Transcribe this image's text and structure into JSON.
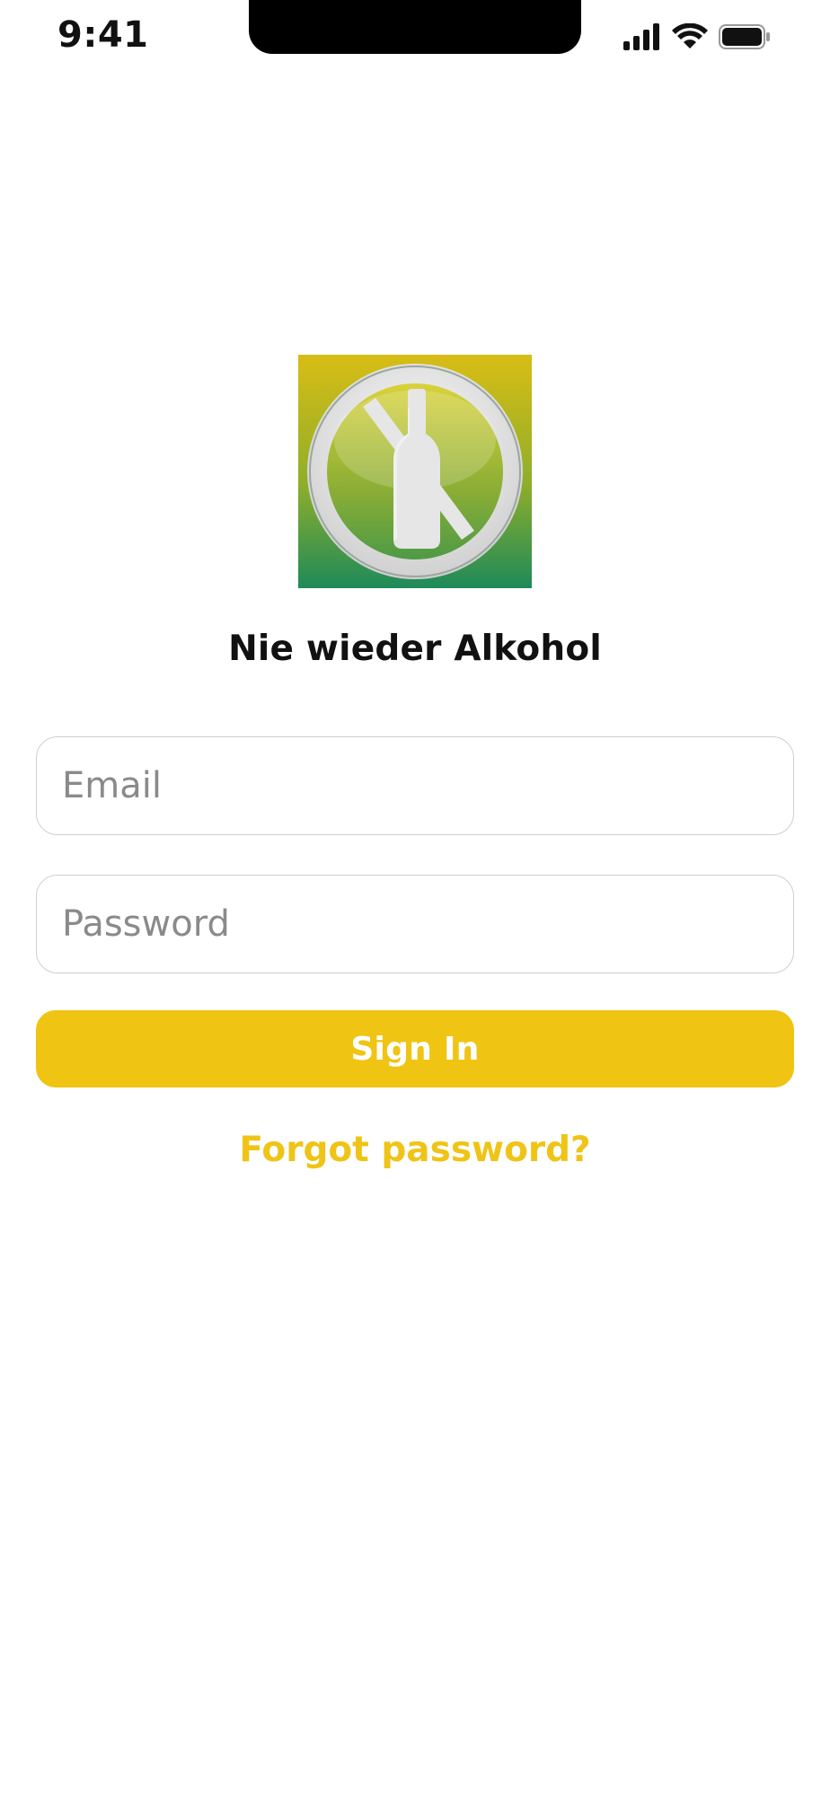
{
  "status_bar": {
    "time": "9:41",
    "icons": [
      "signal-icon",
      "wifi-icon",
      "battery-icon"
    ]
  },
  "logo": {
    "icon": "no-alcohol-bottle-icon",
    "colors": {
      "gradient_top": "#d7bd16",
      "gradient_bottom": "#1f8b58",
      "symbol": "#e6e6e6"
    }
  },
  "app": {
    "title": "Nie wieder Alkohol"
  },
  "form": {
    "email_placeholder": "Email",
    "password_placeholder": "Password",
    "signin_label": "Sign In",
    "forgot_label": "Forgot password?"
  },
  "colors": {
    "accent": "#f0c412",
    "field_border": "#cfcfcf",
    "placeholder": "#8a8a8a"
  }
}
